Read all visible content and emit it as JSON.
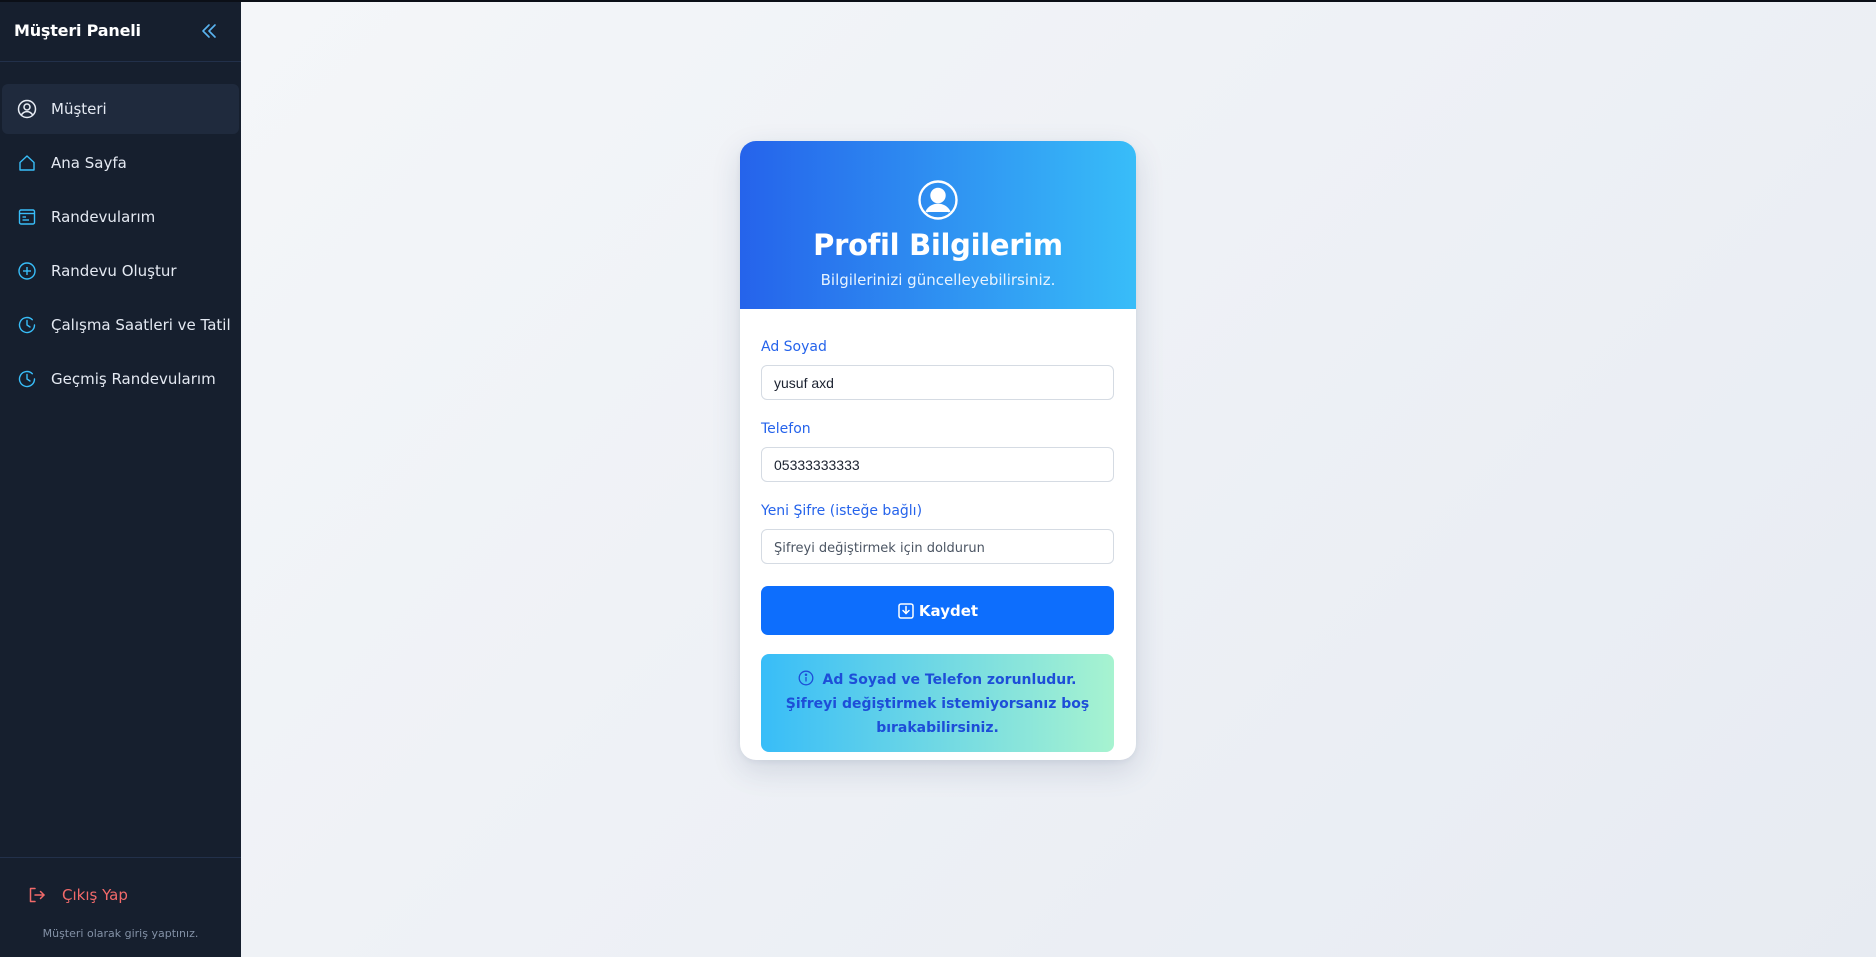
{
  "sidebar": {
    "title": "Müşteri Paneli",
    "items": [
      {
        "label": "Müşteri",
        "icon": "user-circle-icon",
        "active": true
      },
      {
        "label": "Ana Sayfa",
        "icon": "home-icon"
      },
      {
        "label": "Randevularım",
        "icon": "calendar-list-icon"
      },
      {
        "label": "Randevu Oluştur",
        "icon": "plus-circle-icon"
      },
      {
        "label": "Çalışma Saatleri ve Tatil",
        "icon": "clock-icon"
      },
      {
        "label": "Geçmiş Randevularım",
        "icon": "clock-history-icon"
      }
    ],
    "logout_label": "Çıkış Yap",
    "footer_note": "Müşteri olarak giriş yaptınız."
  },
  "profile": {
    "title": "Profil Bilgilerim",
    "subtitle": "Bilgilerinizi güncelleyebilirsiniz.",
    "fields": {
      "name": {
        "label": "Ad Soyad",
        "value": "yusuf axd"
      },
      "phone": {
        "label": "Telefon",
        "value": "05333333333"
      },
      "password": {
        "label": "Yeni Şifre (isteğe bağlı)",
        "placeholder": "Şifreyi değiştirmek için doldurun"
      }
    },
    "save_label": "Kaydet",
    "info_text": "Ad Soyad ve Telefon zorunludur. Şifreyi değiştirmek istemiyorsanız boş bırakabilirsiniz."
  },
  "colors": {
    "sidebar_bg": "#161f2e",
    "accent": "#0d6efd",
    "header_gradient_start": "#2563eb",
    "header_gradient_end": "#38bdf8",
    "logout": "#f26a6a"
  }
}
